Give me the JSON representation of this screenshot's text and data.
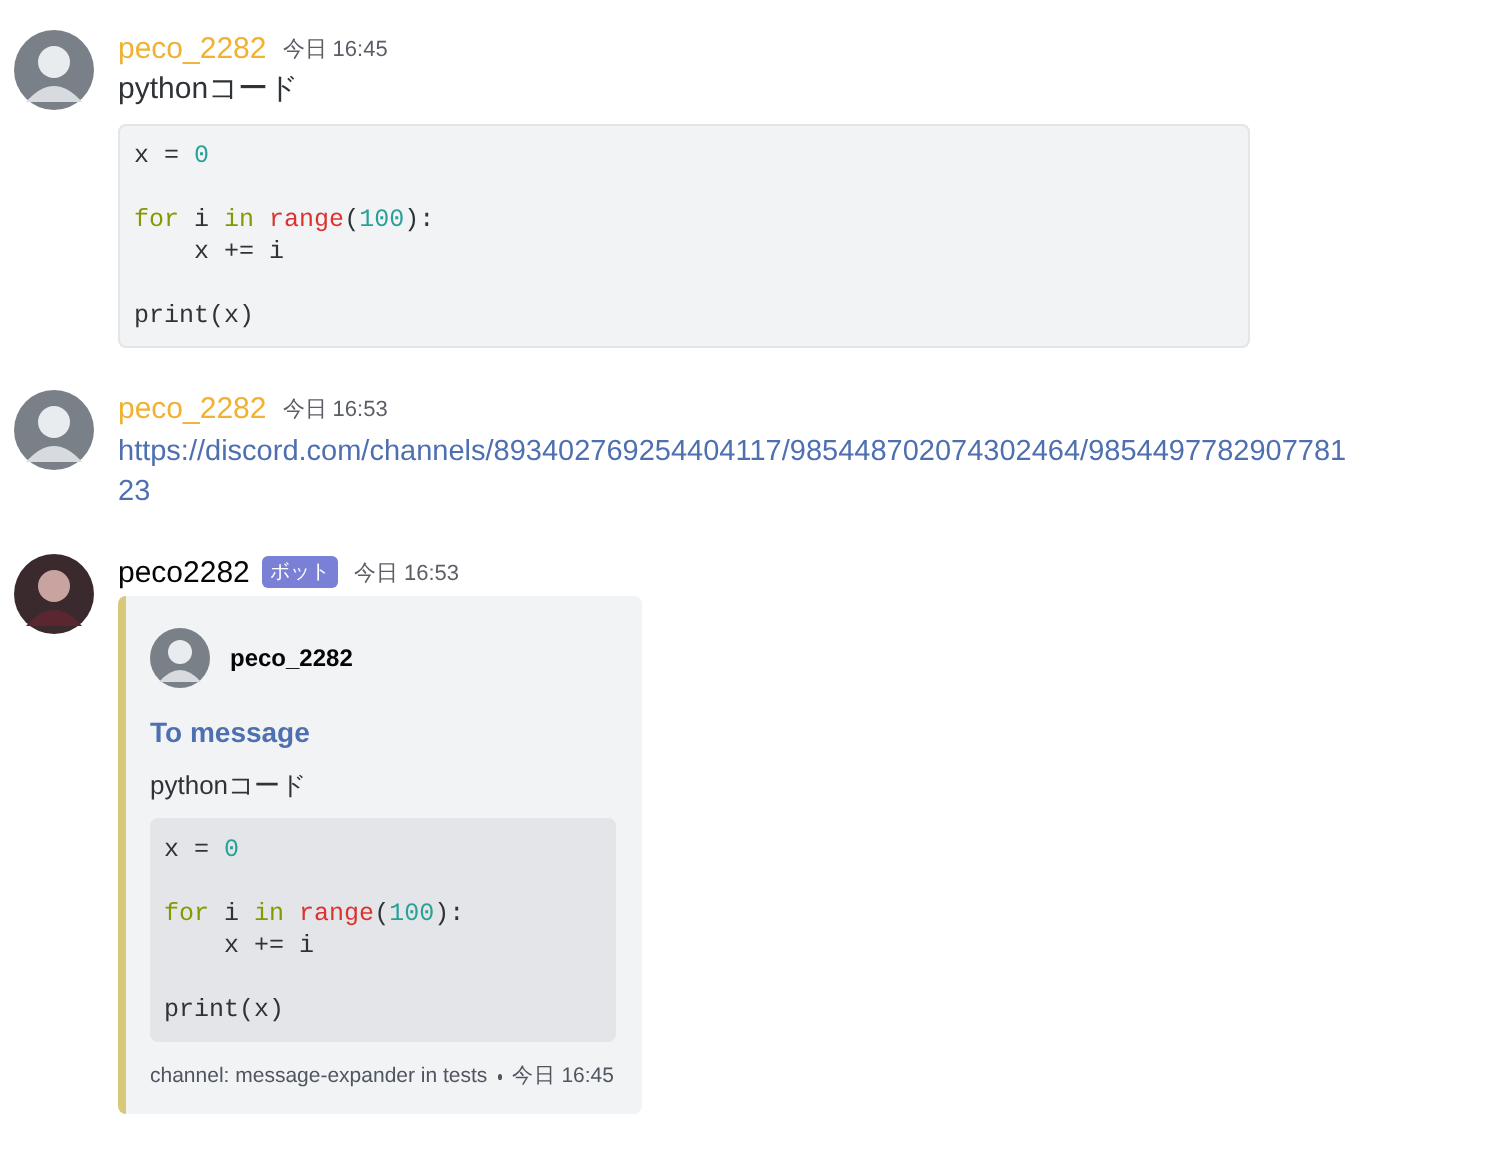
{
  "messages": [
    {
      "kind": "code",
      "author": "peco_2282",
      "color": "#f0b232",
      "time": "今日 16:45",
      "text": "pythonコード",
      "code": [
        {
          "kind": "code",
          "tokens": [
            {
              "text": "x = ",
              "color": "#2e3338"
            },
            {
              "text": "0",
              "color": "#2aa198"
            }
          ]
        },
        {
          "kind": "blank"
        },
        {
          "kind": "code",
          "tokens": [
            {
              "text": "for",
              "color": "#859900"
            },
            {
              "text": " i ",
              "color": "#2e3338"
            },
            {
              "text": "in ",
              "color": "#859900"
            },
            {
              "text": "range",
              "color": "#dc322f"
            },
            {
              "text": "(",
              "color": "#2e3338"
            },
            {
              "text": "100",
              "color": "#2aa198"
            },
            {
              "text": "):",
              "color": "#2e3338"
            }
          ]
        },
        {
          "kind": "code",
          "tokens": [
            {
              "text": "    x += i",
              "color": "#2e3338"
            }
          ]
        },
        {
          "kind": "blank"
        },
        {
          "kind": "code",
          "tokens": [
            {
              "text": "print(x)",
              "color": "#2e3338"
            }
          ]
        }
      ]
    },
    {
      "kind": "link",
      "author": "peco_2282",
      "color": "#f0b232",
      "time": "今日 16:53",
      "link": "https://discord.com/channels/893402769254404117/985448702074302464/985449778290778123"
    },
    {
      "kind": "embed",
      "author": "peco2282",
      "color": "#060607",
      "badge": "ボット",
      "time": "今日 16:53",
      "embed": {
        "author": "peco_2282",
        "title": "To message",
        "text": "pythonコード",
        "code": [
          {
            "kind": "code",
            "tokens": [
              {
                "text": "x = ",
                "color": "#2e3338"
              },
              {
                "text": "0",
                "color": "#2aa198"
              }
            ]
          },
          {
            "kind": "blank"
          },
          {
            "kind": "code",
            "tokens": [
              {
                "text": "for",
                "color": "#859900"
              },
              {
                "text": " i ",
                "color": "#2e3338"
              },
              {
                "text": "in ",
                "color": "#859900"
              },
              {
                "text": "range",
                "color": "#dc322f"
              },
              {
                "text": "(",
                "color": "#2e3338"
              },
              {
                "text": "100",
                "color": "#2aa198"
              },
              {
                "text": "):",
                "color": "#2e3338"
              }
            ]
          },
          {
            "kind": "code",
            "tokens": [
              {
                "text": "    x += i",
                "color": "#2e3338"
              }
            ]
          },
          {
            "kind": "blank"
          },
          {
            "kind": "code",
            "tokens": [
              {
                "text": "print(x)",
                "color": "#2e3338"
              }
            ]
          }
        ],
        "footer": "channel: message-expander in tests",
        "footer_time": "今日 16:45"
      }
    }
  ]
}
